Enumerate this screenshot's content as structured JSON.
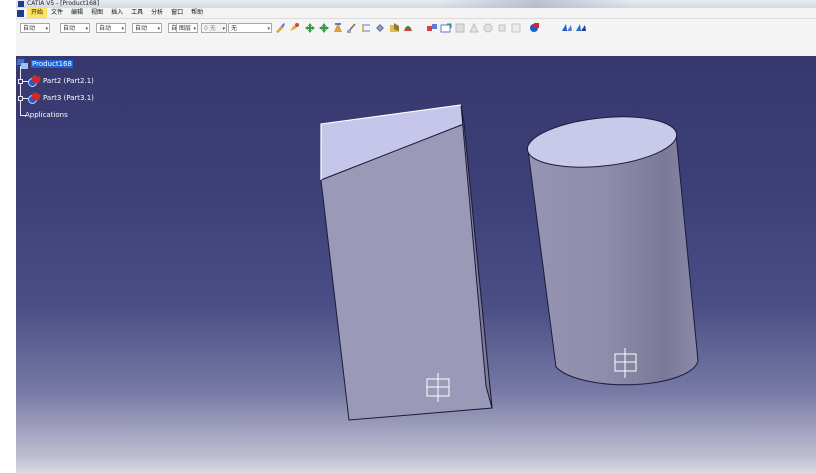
{
  "window": {
    "title": "CATIA V5 - [Product168]"
  },
  "menu": {
    "items": [
      "开始",
      "文件",
      "编辑",
      "视图",
      "插入",
      "工具",
      "分析",
      "窗口",
      "帮助"
    ],
    "active_index": 0
  },
  "toolbar": {
    "selects": [
      {
        "value": "自动"
      },
      {
        "value": "自动"
      },
      {
        "value": "自动"
      },
      {
        "value": "自动"
      },
      {
        "value": "自动"
      },
      {
        "value": "图层"
      },
      {
        "value": "0 无"
      },
      {
        "value": "无"
      }
    ]
  },
  "tree": {
    "root": "Product168",
    "children": [
      "Part2 (Part2.1)",
      "Part3 (Part3.1)"
    ],
    "applications": "Applications"
  },
  "scene": {
    "background_top": "#37386e",
    "background_bottom": "#dadae4",
    "solid_face_light": "#c6c6ea",
    "solid_face_mid": "#9a9ab8",
    "solid_face_dark": "#7c7c98",
    "objects": [
      "rectangular-prism",
      "cylinder"
    ]
  }
}
